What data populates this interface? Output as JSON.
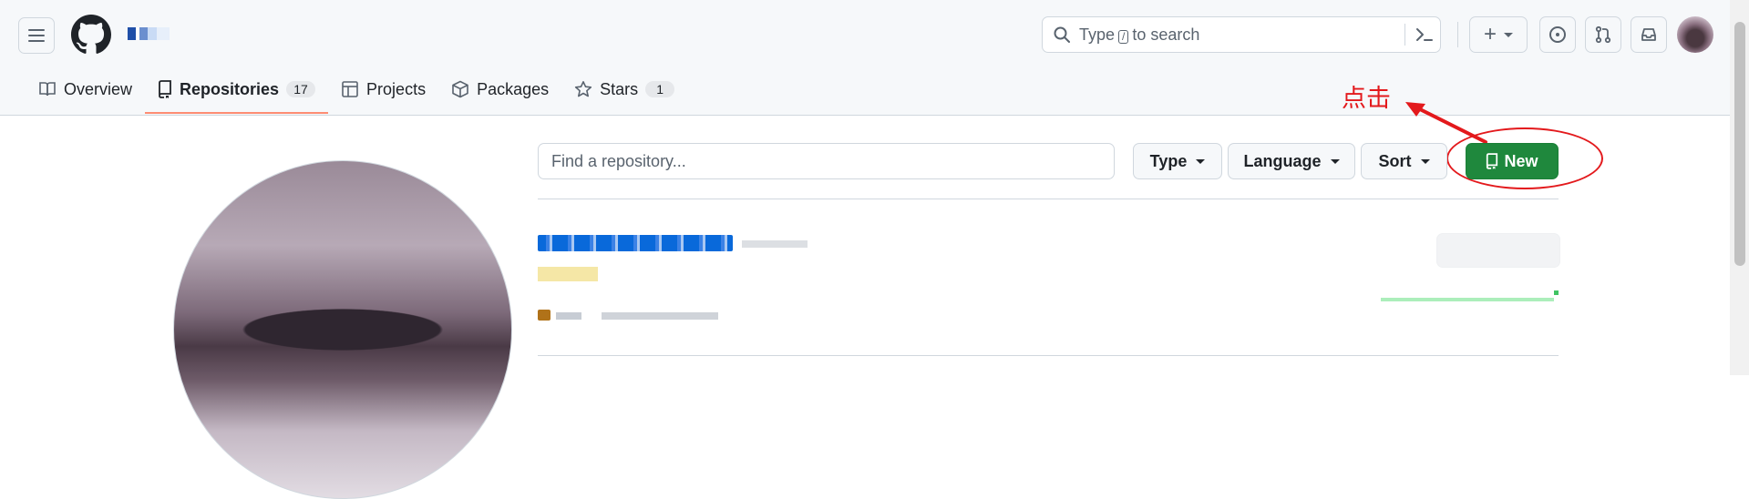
{
  "header": {
    "search": {
      "prefix": "Type",
      "key": "/",
      "suffix": "to search"
    },
    "plus_label": "+"
  },
  "tabs": [
    {
      "label": "Overview",
      "icon": "book-icon"
    },
    {
      "label": "Repositories",
      "icon": "repo-icon",
      "count": "17",
      "selected": true
    },
    {
      "label": "Projects",
      "icon": "table-icon"
    },
    {
      "label": "Packages",
      "icon": "package-icon"
    },
    {
      "label": "Stars",
      "icon": "star-icon",
      "count": "1"
    }
  ],
  "annotation": {
    "text": "点击",
    "color": "#e3191c"
  },
  "filters": {
    "find_placeholder": "Find a repository...",
    "type_label": "Type",
    "language_label": "Language",
    "sort_label": "Sort",
    "new_label": "New"
  },
  "colors": {
    "accent_green": "#1f883d",
    "tab_underline": "#fd8c73",
    "link_blue": "#0969da",
    "language_dot": "#b07219"
  }
}
